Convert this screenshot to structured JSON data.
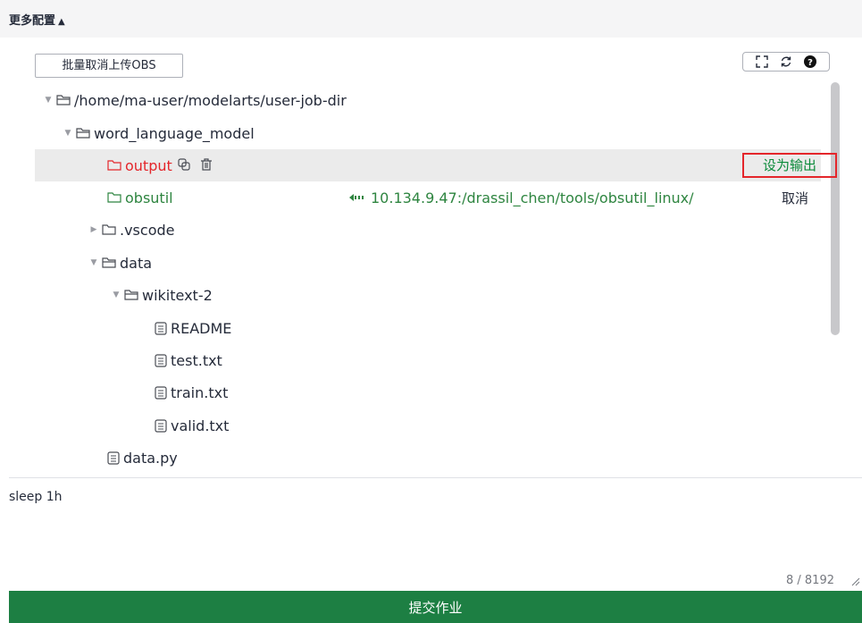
{
  "header": {
    "title": "更多配置",
    "caret": "▲"
  },
  "panel": {
    "batch_button": "批量取消上传OBS",
    "tools": [
      "fullscreen-icon",
      "refresh-icon",
      "help-icon"
    ]
  },
  "tree": {
    "rows": [
      {
        "label": "/home/ma-user/modelarts/user-job-dir",
        "type": "folder-open",
        "expanded": true
      },
      {
        "label": "word_language_model",
        "type": "folder-open",
        "expanded": true
      },
      {
        "label": "output",
        "type": "folder",
        "state": "selected",
        "action": "设为输出"
      },
      {
        "label": "obsutil",
        "type": "folder",
        "state": "linked",
        "link": "10.134.9.47:/drassil_chen/tools/obsutil_linux/",
        "action": "取消"
      },
      {
        "label": ".vscode",
        "type": "folder",
        "expanded": false
      },
      {
        "label": "data",
        "type": "folder-open",
        "expanded": true
      },
      {
        "label": "wikitext-2",
        "type": "folder-open",
        "expanded": true
      },
      {
        "label": "README",
        "type": "file"
      },
      {
        "label": "test.txt",
        "type": "file"
      },
      {
        "label": "train.txt",
        "type": "file"
      },
      {
        "label": "valid.txt",
        "type": "file"
      },
      {
        "label": "data.py",
        "type": "file"
      }
    ]
  },
  "command": {
    "text": "sleep 1h",
    "counter": "8 / 8192"
  },
  "submit": {
    "label": "提交作业"
  },
  "colors": {
    "accent": "#1d7f43",
    "danger": "#e4262b",
    "link": "#2e8540"
  }
}
